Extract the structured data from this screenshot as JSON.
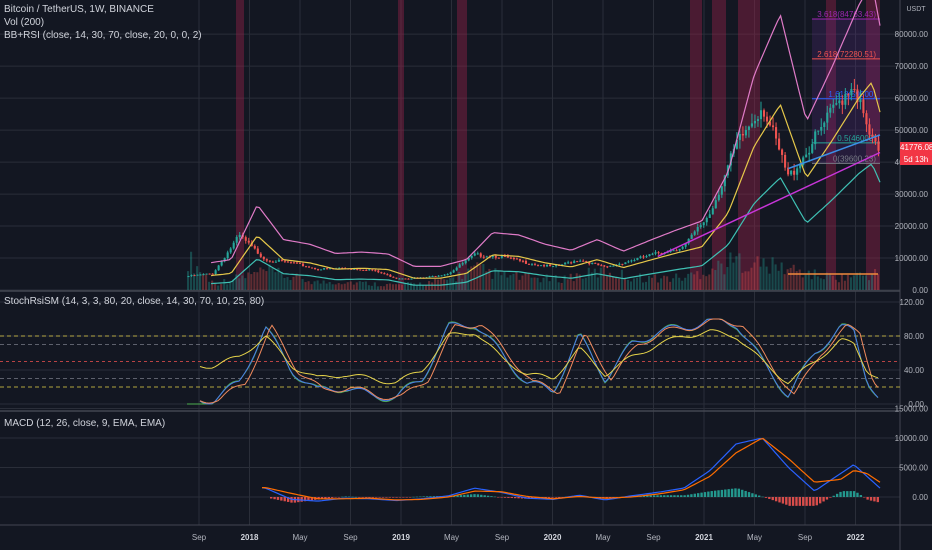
{
  "title": "Bitcoin / TetherUS, 1W, BINANCE",
  "indicators": {
    "vol": "Vol (200)",
    "bbrsi": "BB+RSI (close, 14, 30, 70, close, 20, 0, 0, 2)",
    "stoch": "StochRsiSM (14, 3, 3, 80, 20, close, 14, 30, 70, 10, 25, 80)",
    "macd": "MACD (12, 26, close, 9, EMA, EMA)"
  },
  "price_axis": {
    "currency": "USDT",
    "ticks": [
      "80000.00",
      "70000.00",
      "60000.00",
      "50000.00",
      "40000.00",
      "30000.00",
      "20000.00",
      "10000.00",
      "0.00"
    ],
    "last_price": "41776.08",
    "countdown": "5d 13h"
  },
  "stoch_axis": {
    "ticks": [
      "120.00",
      "80.00",
      "40.00",
      "0.00"
    ]
  },
  "macd_axis": {
    "ticks": [
      "15000.00",
      "10000.00",
      "5000.00",
      "0.00"
    ]
  },
  "time_axis": [
    "Sep",
    "2018",
    "May",
    "Sep",
    "2019",
    "May",
    "Sep",
    "2020",
    "May",
    "Sep",
    "2021",
    "May",
    "Sep",
    "2022"
  ],
  "fib_labels": [
    "3.618(84763.43)",
    "2.618(72280.51)",
    "1.618(59800)",
    "0.5(46000)",
    "0(39600.23)"
  ],
  "colors": {
    "bg": "#131722",
    "grid": "#2a2e39",
    "up": "#26a69a",
    "down": "#ef5350",
    "bb_upper": "#e07bc8",
    "bb_basis": "#e6c84a",
    "bb_lower": "#3fc1b4",
    "rsi_highlight": "#8e2246",
    "trend": "#c735d8",
    "trend2": "#3b8fe6",
    "stoch_k": "#4a7ce8",
    "stoch_d": "#f08a5d",
    "stoch_rsi": "#e6d44a",
    "stoch_env": "#4caf50",
    "macd": "#2962ff",
    "signal": "#ff6d00",
    "hist_up": "#26a69a",
    "hist_down": "#ef5350",
    "price_tag": "#f23645"
  },
  "chart_data": {
    "type": "line",
    "title": "Bitcoin / TetherUS, 1W, BINANCE",
    "x": [
      "2017-08",
      "2017-10",
      "2017-12",
      "2018-02",
      "2018-04",
      "2018-06",
      "2018-08",
      "2018-10",
      "2018-12",
      "2019-02",
      "2019-04",
      "2019-06",
      "2019-08",
      "2019-10",
      "2019-12",
      "2020-02",
      "2020-04",
      "2020-06",
      "2020-08",
      "2020-10",
      "2020-12",
      "2021-02",
      "2021-04",
      "2021-06",
      "2021-08",
      "2021-10",
      "2021-11",
      "2021-12",
      "2022-01"
    ],
    "series": [
      {
        "values": [
          4300,
          5200,
          17000,
          9500,
          8500,
          6500,
          6800,
          6400,
          3700,
          3700,
          5200,
          11000,
          10500,
          8500,
          7200,
          9500,
          7000,
          9300,
          11500,
          13500,
          24000,
          45000,
          58000,
          35000,
          47000,
          60000,
          65000,
          50000,
          41776
        ]
      },
      {
        "values": [
          7.5,
          1.5,
          3,
          4.5,
          3,
          1.8,
          2,
          1.5,
          1.2,
          1.6,
          2.5,
          5,
          3.5,
          3,
          2.5,
          3.5,
          4.5,
          3,
          2.8,
          3,
          5,
          7,
          6,
          5,
          3.5,
          3,
          3.5,
          3.5,
          4.3
        ]
      },
      {
        "values": [
          null,
          5,
          25,
          90,
          40,
          15,
          20,
          10,
          8,
          30,
          90,
          95,
          60,
          25,
          15,
          80,
          30,
          70,
          85,
          90,
          98,
          95,
          50,
          10,
          60,
          90,
          85,
          30,
          5
        ]
      },
      {
        "values": [
          null,
          45,
          55,
          80,
          45,
          30,
          35,
          30,
          25,
          40,
          80,
          85,
          55,
          35,
          30,
          65,
          35,
          55,
          70,
          80,
          85,
          80,
          50,
          25,
          50,
          75,
          70,
          40,
          30
        ]
      },
      {
        "values": [
          null,
          null,
          2200,
          1500,
          -400,
          -700,
          -200,
          -300,
          -600,
          -300,
          200,
          1500,
          800,
          -200,
          -400,
          300,
          -500,
          200,
          800,
          1500,
          4500,
          9000,
          10000,
          5000,
          1000,
          4000,
          5500,
          3500,
          1500
        ]
      },
      {
        "values": [
          null,
          null,
          1500,
          1600,
          600,
          -300,
          -300,
          -200,
          -500,
          -400,
          0,
          1000,
          900,
          100,
          -300,
          100,
          -200,
          0,
          500,
          1200,
          3500,
          7500,
          10000,
          6500,
          2500,
          3000,
          4500,
          4000,
          2500
        ]
      }
    ],
    "ylim": [
      0,
      90000
    ]
  }
}
